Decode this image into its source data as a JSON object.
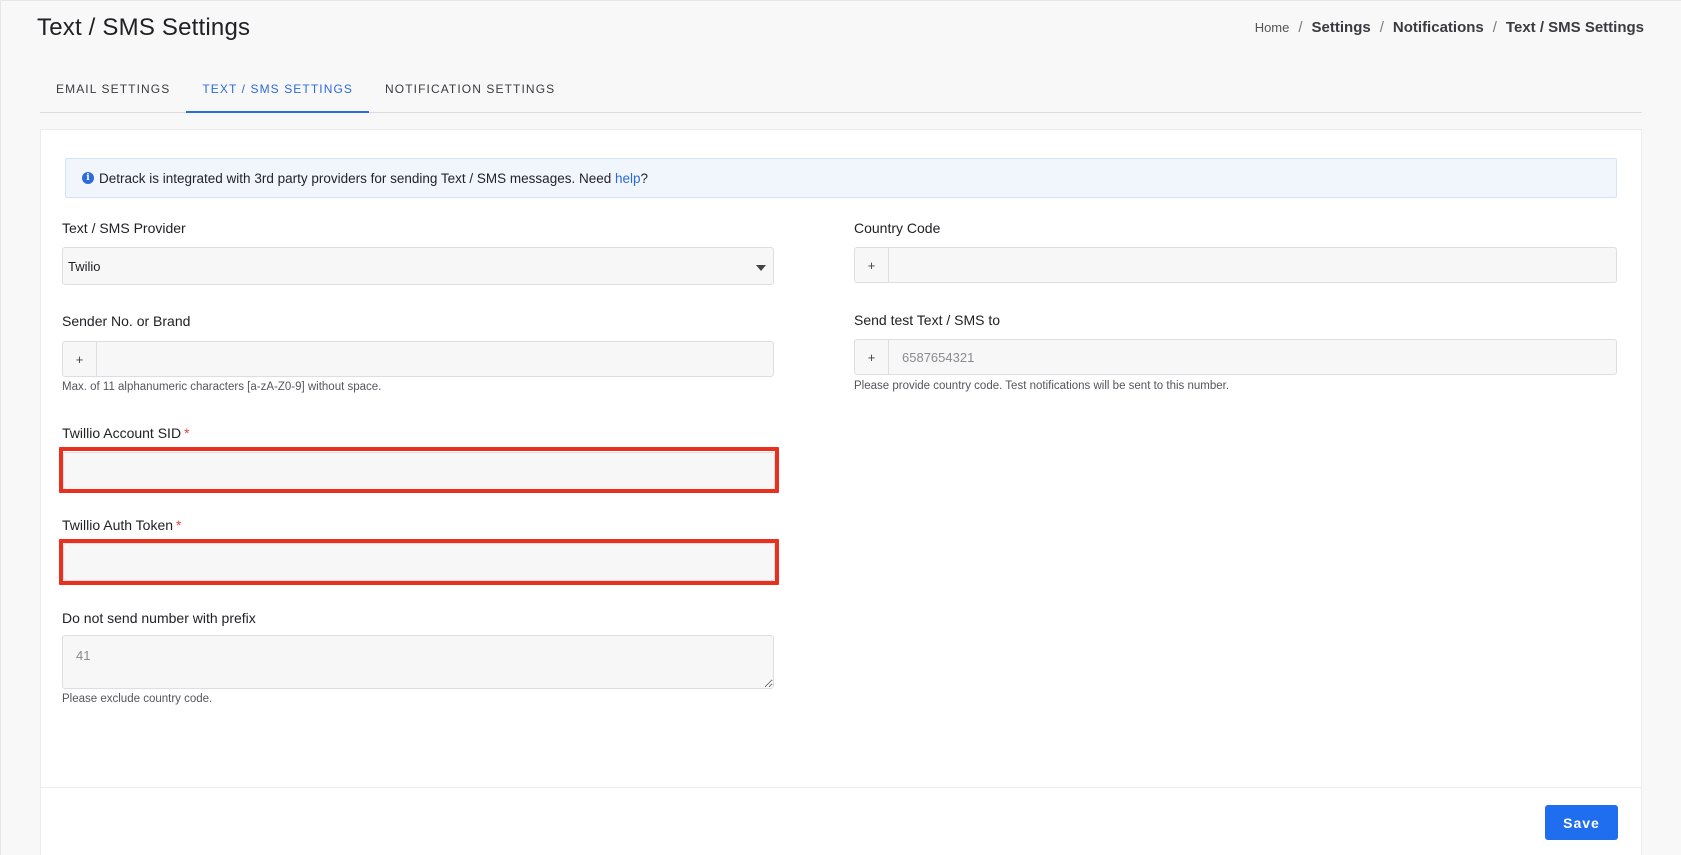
{
  "page": {
    "title": "Text / SMS Settings"
  },
  "breadcrumb": {
    "home": "Home",
    "items": [
      "Settings",
      "Notifications",
      "Text / SMS Settings"
    ],
    "separator": "/"
  },
  "tabs": [
    {
      "label": "EMAIL SETTINGS",
      "active": false
    },
    {
      "label": "TEXT / SMS SETTINGS",
      "active": true
    },
    {
      "label": "NOTIFICATION SETTINGS",
      "active": false
    }
  ],
  "info": {
    "icon": "info-circle-icon",
    "icon_glyph": "i",
    "text": "Detrack is integrated with 3rd party providers for sending Text / SMS messages. Need ",
    "link": "help",
    "suffix": "?"
  },
  "form": {
    "provider": {
      "label": "Text / SMS Provider",
      "value": "Twilio"
    },
    "country_code": {
      "label": "Country Code",
      "prefix": "+",
      "value": ""
    },
    "sender": {
      "label": "Sender No. or Brand",
      "prefix": "+",
      "value": "",
      "help": "Max. of 11 alphanumeric characters [a-zA-Z0-9] without space."
    },
    "test_to": {
      "label": "Send test Text / SMS to",
      "prefix": "+",
      "placeholder": "6587654321",
      "help": "Please provide country code. Test notifications will be sent to this number."
    },
    "account_sid": {
      "label": "Twillio Account SID",
      "required_mark": "*",
      "value": ""
    },
    "auth_token": {
      "label": "Twillio Auth Token",
      "required_mark": "*",
      "value": ""
    },
    "exclude_prefix": {
      "label": "Do not send number with prefix",
      "placeholder": "41",
      "help": "Please exclude country code."
    }
  },
  "actions": {
    "save_label": "Save"
  },
  "colors": {
    "accent": "#2d6bd8",
    "save_button": "#1f6ef0",
    "highlight": "#e8301c",
    "required": "#e24343"
  }
}
